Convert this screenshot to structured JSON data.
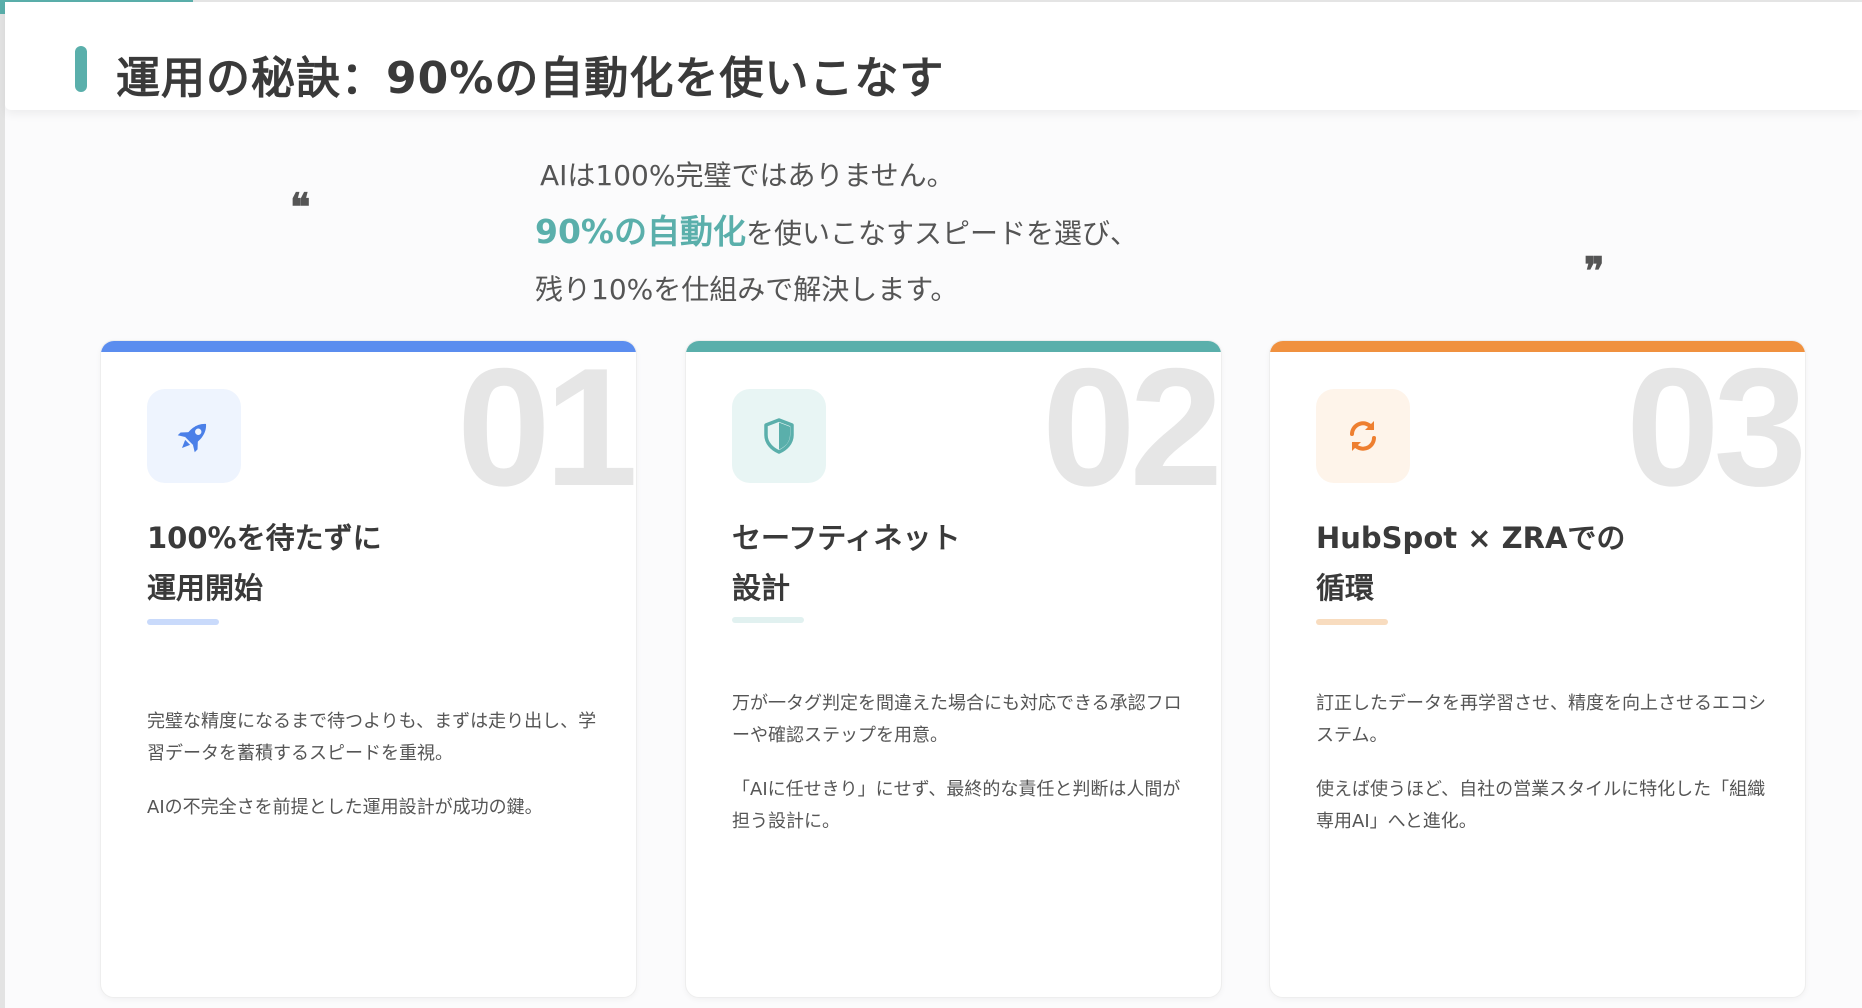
{
  "header": {
    "title": "運用の秘訣：90%の自動化を使いこなす"
  },
  "quote": {
    "line1": "AIは100%完璧ではありません。",
    "line2_highlight": "90%の自動化",
    "line2_rest": "を使いこなすスピードを選び、",
    "line3": "残り10%を仕組みで解決します。",
    "open_mark": "❝",
    "close_mark": "❞"
  },
  "cards": [
    {
      "number": "01",
      "title_line1": "100%を待たずに",
      "title_line2": "運用開始",
      "icon": "rocket-icon",
      "accent": "#5b8def",
      "para1": "完璧な精度になるまで待つよりも、まずは走り出し、学習データを蓄積するスピードを重視。",
      "para2": "AIの不完全さを前提とした運用設計が成功の鍵。"
    },
    {
      "number": "02",
      "title_line1": "セーフティネット",
      "title_line2": "設計",
      "icon": "shield-icon",
      "accent": "#5aafab",
      "para1": "万が一タグ判定を間違えた場合にも対応できる承認フローや確認ステップを用意。",
      "para2": "「AIに任せきり」にせず、最終的な責任と判断は人間が担う設計に。"
    },
    {
      "number": "03",
      "title_line1": "HubSpot × ZRAでの",
      "title_line2": "循環",
      "icon": "sync-icon",
      "accent": "#f0913f",
      "para1": "訂正したデータを再学習させ、精度を向上させるエコシステム。",
      "para2": "使えば使うほど、自社の営業スタイルに特化した「組織専用AI」へと進化。"
    }
  ]
}
